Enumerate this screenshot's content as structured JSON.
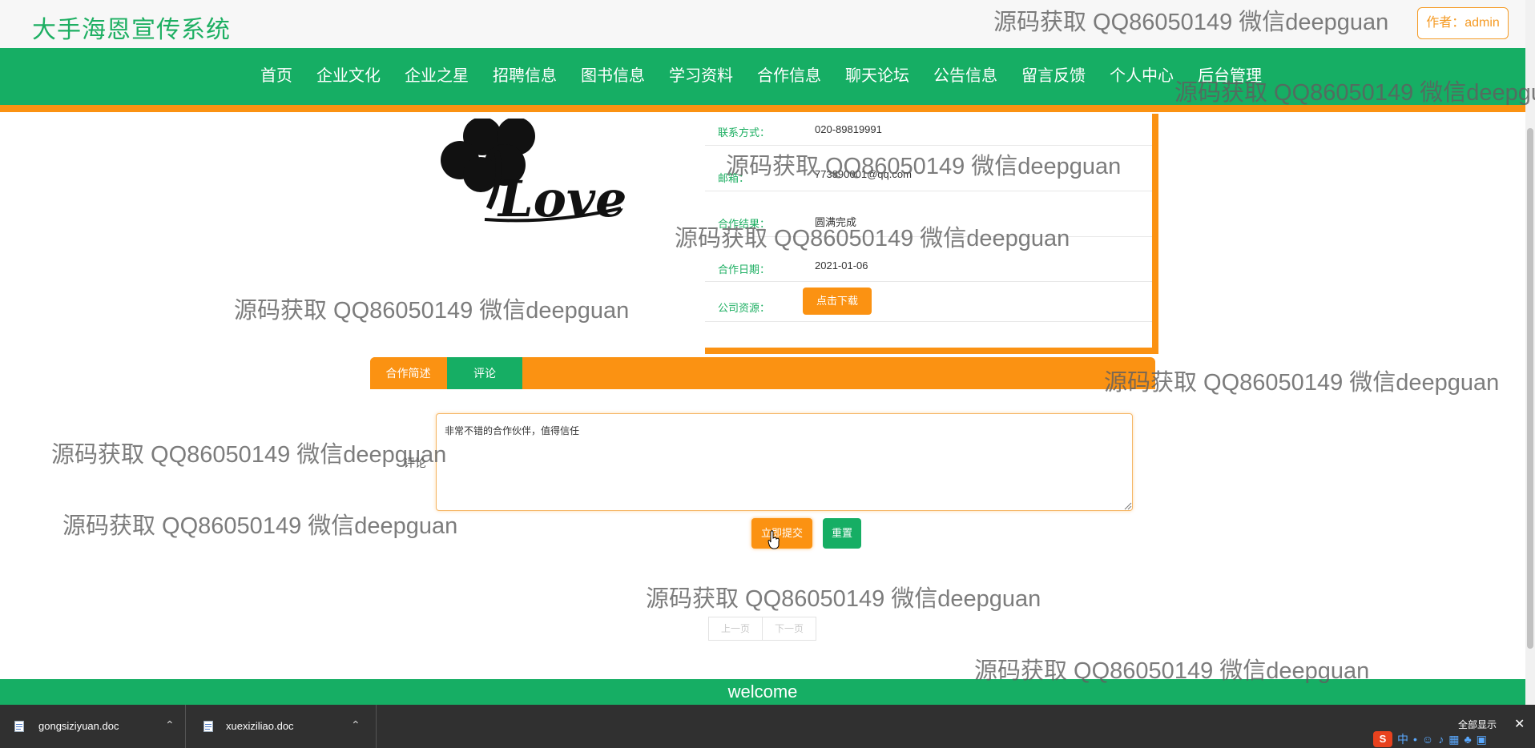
{
  "header": {
    "site_title": "大手海恩宣传系统",
    "author": "作者：admin"
  },
  "nav": {
    "items": [
      "首页",
      "企业文化",
      "企业之星",
      "招聘信息",
      "图书信息",
      "学习资料",
      "合作信息",
      "聊天论坛",
      "公告信息",
      "留言反馈",
      "个人中心",
      "后台管理"
    ]
  },
  "detail": {
    "rows": [
      {
        "label": "联系方式：",
        "value": "020-89819991"
      },
      {
        "label": "邮箱：",
        "value": "773890001@qq.com"
      },
      {
        "label": "合作结果：",
        "value": "圆满完成"
      },
      {
        "label": "合作日期：",
        "value": "2021-01-06"
      },
      {
        "label": "公司资源："
      }
    ],
    "download_label": "点击下载"
  },
  "tabs": {
    "desc": "合作简述",
    "comment": "评论"
  },
  "comment": {
    "label": "评论",
    "value": "非常不错的合作伙伴，值得信任",
    "submit": "立即提交",
    "reset": "重置"
  },
  "pager": {
    "prev": "上一页",
    "next": "下一页"
  },
  "footer": {
    "text": "welcome"
  },
  "downloads": [
    {
      "name": "gongsiziyuan.doc"
    },
    {
      "name": "xuexiziliao.doc"
    }
  ],
  "taskbar": {
    "show_all": "全部显示",
    "tray_logo": "S",
    "tray_ime": "中"
  },
  "watermark": "源码获取 QQ86050149 微信deepguan",
  "colors": {
    "brand_green": "#16ae64",
    "brand_orange": "#fb9212"
  }
}
